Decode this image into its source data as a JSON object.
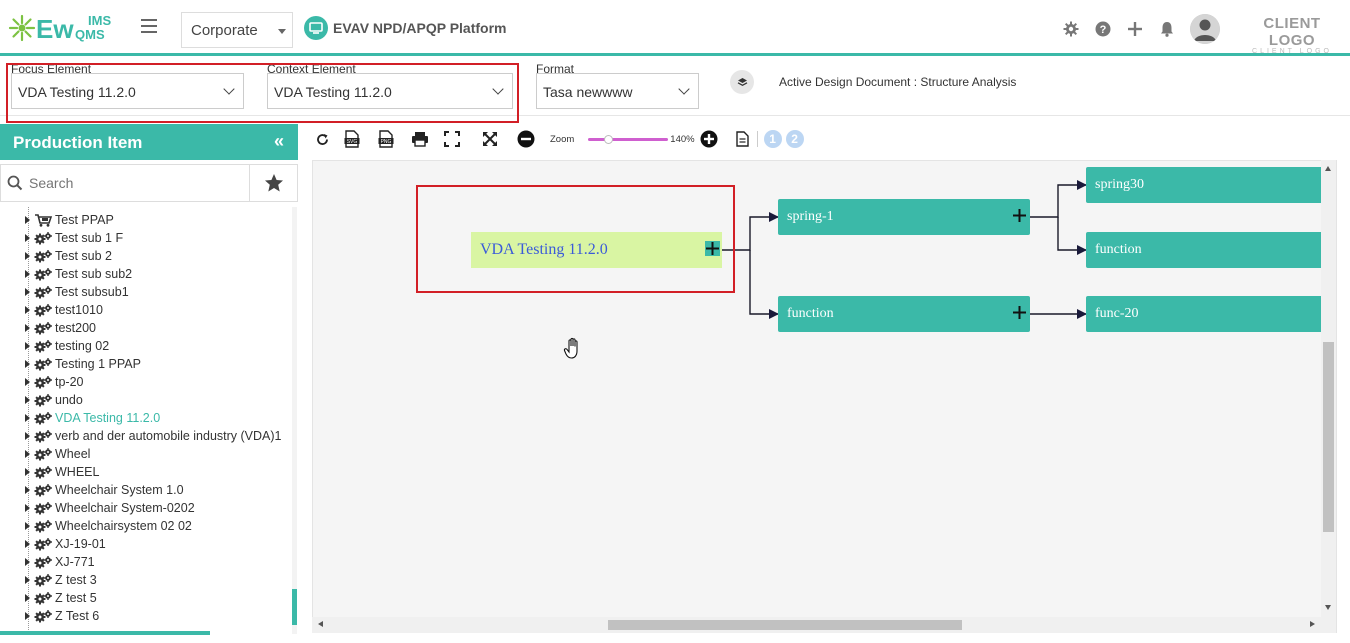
{
  "header": {
    "logo_main": "Ew",
    "logo_ims": "IMS",
    "logo_qms": "QMS",
    "corporate_select": "Corporate",
    "platform_title": "EVAV NPD/APQP Platform",
    "client_logo": "CLIENT LOGO",
    "client_logo_sub": "CLIENT LOGO",
    "icons": [
      "gear-icon",
      "help-icon",
      "plus-icon",
      "bell-icon",
      "avatar"
    ]
  },
  "filters": {
    "focus_label": "Focus Element",
    "focus_value": "VDA Testing 11.2.0",
    "context_label": "Context Element",
    "context_value": "VDA Testing 11.2.0",
    "format_label": "Format",
    "format_value": "Tasa newwww",
    "active_document": "Active Design Document : Structure Analysis"
  },
  "sidebar": {
    "title": "Production Item",
    "search_placeholder": "Search",
    "items": [
      {
        "label": "Test PPAP",
        "icon": "cart-gear-icon"
      },
      {
        "label": "Test sub 1 F",
        "icon": "gears-icon"
      },
      {
        "label": "Test sub 2",
        "icon": "gears-icon"
      },
      {
        "label": "Test sub sub2",
        "icon": "gears-icon"
      },
      {
        "label": "Test subsub1",
        "icon": "gears-icon"
      },
      {
        "label": "test1010",
        "icon": "gears-icon"
      },
      {
        "label": "test200",
        "icon": "gears-icon"
      },
      {
        "label": "testing 02",
        "icon": "gears-icon"
      },
      {
        "label": "Testing 1 PPAP",
        "icon": "gears-icon"
      },
      {
        "label": "tp-20",
        "icon": "gears-icon"
      },
      {
        "label": "undo",
        "icon": "gears-icon"
      },
      {
        "label": "VDA Testing 11.2.0",
        "icon": "gears-icon",
        "active": true
      },
      {
        "label": "verb and der automobile industry (VDA)1",
        "icon": "gears-icon"
      },
      {
        "label": "Wheel",
        "icon": "gears-icon"
      },
      {
        "label": "WHEEL",
        "icon": "gears-icon"
      },
      {
        "label": "Wheelchair System 1.0",
        "icon": "gears-icon"
      },
      {
        "label": "Wheelchair System-0202",
        "icon": "gears-icon"
      },
      {
        "label": "Wheelchairsystem 02 02",
        "icon": "gears-icon"
      },
      {
        "label": "XJ-19-01",
        "icon": "gears-icon"
      },
      {
        "label": "XJ-771",
        "icon": "gears-icon"
      },
      {
        "label": "Z test 3",
        "icon": "gears-icon"
      },
      {
        "label": "Z test 5",
        "icon": "gears-icon"
      },
      {
        "label": "Z Test 6",
        "icon": "gears-icon"
      }
    ]
  },
  "toolbar": {
    "zoom_label": "Zoom",
    "zoom_value": "140%",
    "zoom_fraction": 0.2,
    "pages": [
      "1",
      "2"
    ]
  },
  "diagram": {
    "root": "VDA Testing 11.2.0",
    "nodes": {
      "spring1": "spring-1",
      "function1": "function",
      "spring30": "spring30",
      "function2": "function",
      "func20": "func-20"
    },
    "colors": {
      "node": "#3bb9a8",
      "root_bg": "#d9f5a3",
      "root_text": "#3a5bd9",
      "highlight": "#d21f26"
    }
  }
}
